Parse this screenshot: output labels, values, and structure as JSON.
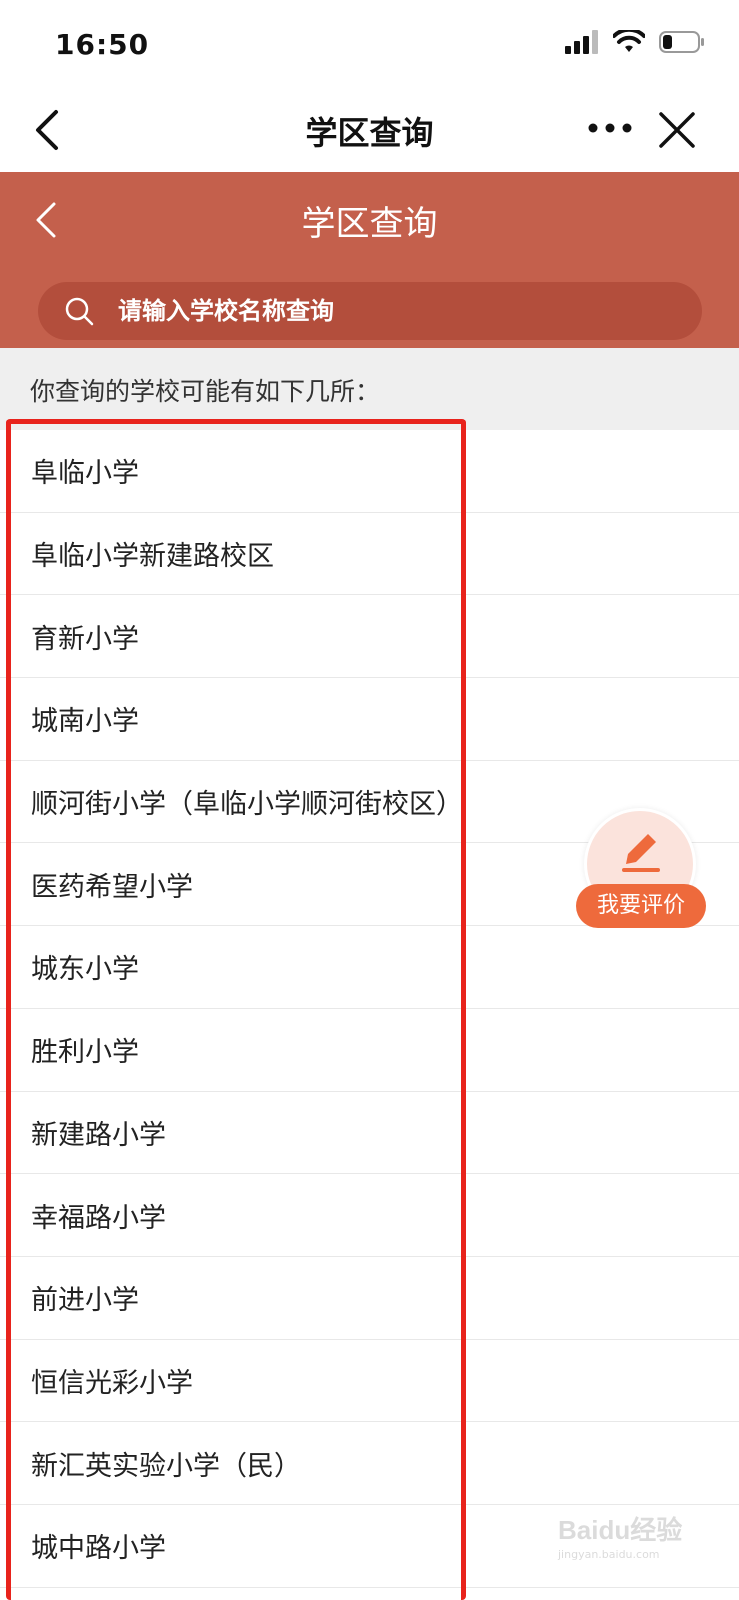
{
  "status_bar": {
    "time": "16:50"
  },
  "wechat_nav": {
    "title": "学区查询"
  },
  "header": {
    "title": "学区查询",
    "search_placeholder": "请输入学校名称查询",
    "color": "#c4604c"
  },
  "hint": "你查询的学校可能有如下几所：",
  "schools": [
    "阜临小学",
    "阜临小学新建路校区",
    "育新小学",
    "城南小学",
    "顺河街小学（阜临小学顺河街校区）",
    "医药希望小学",
    "城东小学",
    "胜利小学",
    "新建路小学",
    "幸福路小学",
    "前进小学",
    "恒信光彩小学",
    "新汇英实验小学（民）",
    "城中路小学"
  ],
  "rate_button": {
    "label": "我要评价",
    "color": "#ee6a3c"
  },
  "watermark": {
    "logo": "Baidu经验",
    "url": "jingyan.baidu.com"
  },
  "highlight_color": "#e8231c"
}
